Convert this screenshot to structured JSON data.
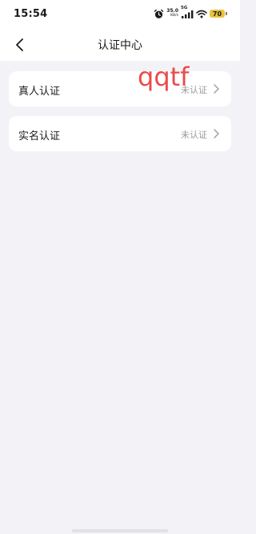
{
  "status_bar": {
    "time": "15:54",
    "net_speed_value": "35.0",
    "net_speed_unit": "KB/s",
    "network_type": "5G",
    "battery_level": "70",
    "battery_color": "#e8c43b",
    "icons": [
      "alarm-icon",
      "signal-icon",
      "wifi-icon",
      "battery-icon"
    ]
  },
  "nav": {
    "back_icon": "chevron-left-icon",
    "title": "认证中心"
  },
  "cards": [
    {
      "label": "真人认证",
      "status": "未认证",
      "icon": "chevron-right-icon"
    },
    {
      "label": "实名认证",
      "status": "未认证",
      "icon": "chevron-right-icon"
    }
  ],
  "overlay": {
    "watermark_text": "qqtf",
    "watermark_color": "#ea4b4b"
  },
  "colors": {
    "background": "#f3f3f7",
    "card": "#ffffff",
    "status_text": "#9a9a9a"
  }
}
